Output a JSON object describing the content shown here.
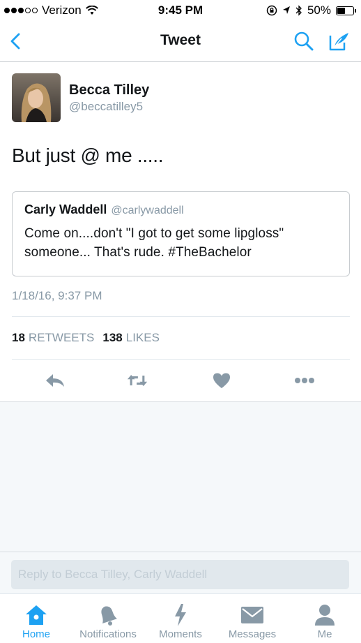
{
  "status_bar": {
    "carrier": "Verizon",
    "time": "9:45 PM",
    "battery": "50%",
    "battery_level": 0.5
  },
  "nav": {
    "title": "Tweet",
    "back_icon": "chevron-left-icon",
    "search_icon": "search-icon",
    "compose_icon": "compose-icon"
  },
  "tweet": {
    "author_name": "Becca Tilley",
    "author_handle": "@beccatilley5",
    "text": "But just @ me .....",
    "timestamp": "1/18/16, 9:37 PM",
    "retweets_count": "18",
    "retweets_label": "RETWEETS",
    "likes_count": "138",
    "likes_label": "LIKES"
  },
  "quoted_tweet": {
    "author_name": "Carly Waddell",
    "author_handle": "@carlywaddell",
    "text": "Come on....don't \"I got to get some lipgloss\" someone... That's rude. #TheBachelor"
  },
  "reply": {
    "placeholder": "Reply to Becca Tilley, Carly Waddell"
  },
  "tabs": [
    {
      "label": "Home",
      "icon": "home-icon",
      "active": true
    },
    {
      "label": "Notifications",
      "icon": "bell-icon",
      "active": false
    },
    {
      "label": "Moments",
      "icon": "lightning-icon",
      "active": false
    },
    {
      "label": "Messages",
      "icon": "envelope-icon",
      "active": false
    },
    {
      "label": "Me",
      "icon": "person-icon",
      "active": false
    }
  ],
  "colors": {
    "accent": "#1da1f2",
    "icon_gray": "#8899a6",
    "text_dark": "#14171a"
  }
}
